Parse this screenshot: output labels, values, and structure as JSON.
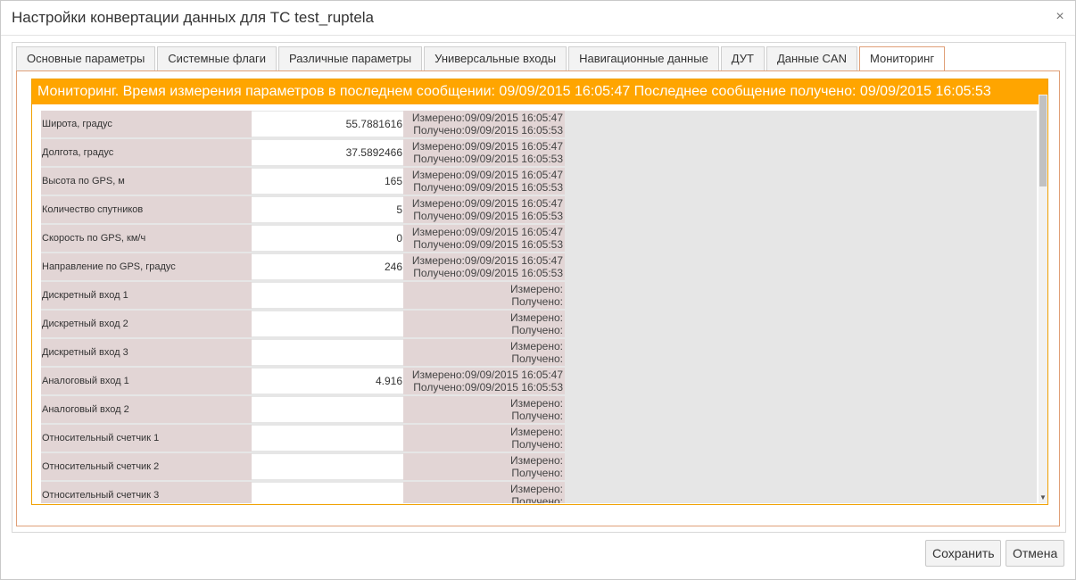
{
  "dialog": {
    "title": "Настройки конвертации данных для ТС test_ruptela",
    "close_glyph": "×"
  },
  "tabs": [
    {
      "label": "Основные параметры"
    },
    {
      "label": "Системные флаги"
    },
    {
      "label": "Различные параметры"
    },
    {
      "label": "Универсальные входы"
    },
    {
      "label": "Навигационные данные"
    },
    {
      "label": "ДУТ"
    },
    {
      "label": "Данные CAN"
    },
    {
      "label": "Мониторинг"
    }
  ],
  "active_tab": "Мониторинг",
  "monitoring": {
    "banner": "Мониторинг. Время измерения параметров в последнем сообщении: 09/09/2015 16:05:47 Последнее сообщение получено: 09/09/2015 16:05:53",
    "rows": [
      {
        "label": "Широта, градус",
        "value": "55.7881616",
        "measured": "Измерено:09/09/2015 16:05:47",
        "received": "Получено:09/09/2015 16:05:53"
      },
      {
        "label": "Долгота, градус",
        "value": "37.5892466",
        "measured": "Измерено:09/09/2015 16:05:47",
        "received": "Получено:09/09/2015 16:05:53"
      },
      {
        "label": "Высота по GPS, м",
        "value": "165",
        "measured": "Измерено:09/09/2015 16:05:47",
        "received": "Получено:09/09/2015 16:05:53"
      },
      {
        "label": "Количество спутников",
        "value": "5",
        "measured": "Измерено:09/09/2015 16:05:47",
        "received": "Получено:09/09/2015 16:05:53"
      },
      {
        "label": "Скорость по GPS, км/ч",
        "value": "0",
        "measured": "Измерено:09/09/2015 16:05:47",
        "received": "Получено:09/09/2015 16:05:53"
      },
      {
        "label": "Направление по GPS, градус",
        "value": "246",
        "measured": "Измерено:09/09/2015 16:05:47",
        "received": "Получено:09/09/2015 16:05:53"
      },
      {
        "label": "Дискретный вход 1",
        "value": "",
        "measured": "Измерено:",
        "received": "Получено:"
      },
      {
        "label": "Дискретный вход 2",
        "value": "",
        "measured": "Измерено:",
        "received": "Получено:"
      },
      {
        "label": "Дискретный вход 3",
        "value": "",
        "measured": "Измерено:",
        "received": "Получено:"
      },
      {
        "label": "Аналоговый вход 1",
        "value": "4.916",
        "measured": "Измерено:09/09/2015 16:05:47",
        "received": "Получено:09/09/2015 16:05:53"
      },
      {
        "label": "Аналоговый вход 2",
        "value": "",
        "measured": "Измерено:",
        "received": "Получено:"
      },
      {
        "label": "Относительный счетчик 1",
        "value": "",
        "measured": "Измерено:",
        "received": "Получено:"
      },
      {
        "label": "Относительный счетчик 2",
        "value": "",
        "measured": "Измерено:",
        "received": "Получено:"
      },
      {
        "label": "Относительный счетчик 3",
        "value": "",
        "measured": "Измерено:",
        "received": "Получено:"
      }
    ]
  },
  "footer": {
    "save_label": "Сохранить",
    "cancel_label": "Отмена"
  },
  "colors": {
    "banner": "#ffa500",
    "label_bg": "#e2d5d5",
    "grid_bg": "#e6e6e6"
  },
  "icons": {
    "close": "close-icon",
    "scroll_down": "chevron-down-icon"
  }
}
